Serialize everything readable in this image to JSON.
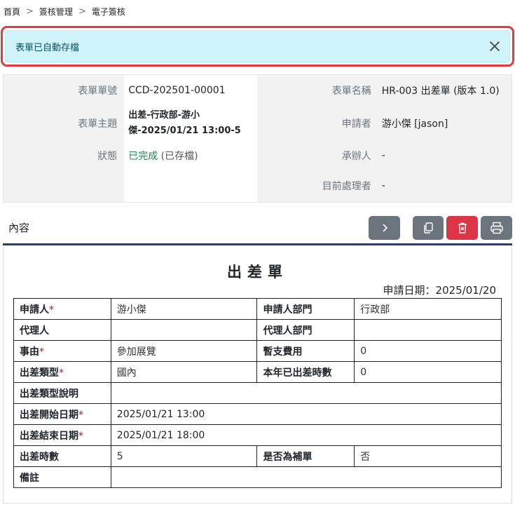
{
  "breadcrumb": [
    "首頁",
    "簽核管理",
    "電子簽核"
  ],
  "alert": {
    "text": "表單已自動存檔"
  },
  "info": {
    "form_no_label": "表單單號",
    "form_no": "CCD-202501-00001",
    "form_name_label": "表單名稱",
    "form_name": "HR-003 出差單 (版本 1.0)",
    "subject_label": "表單主題",
    "subject_line1": "出差-行政部-游小",
    "subject_line2": "傑-2025/01/21 13:00-5",
    "applicant_label": "申請者",
    "applicant": "游小傑 [jason]",
    "status_label": "狀態",
    "status_value": "已完成",
    "status_extra": "(已存檔)",
    "handler_label": "承辦人",
    "handler": "-",
    "processor_label": "目前處理者",
    "processor": "-"
  },
  "content": {
    "title": "內容"
  },
  "toolbar": {
    "next_icon": "chevron-right-icon",
    "copy_icon": "copy-icon",
    "delete_icon": "trash-icon",
    "print_icon": "printer-icon",
    "colors": {
      "gray": "#6c757d",
      "red": "#dc3545"
    }
  },
  "document": {
    "title": "出差單",
    "apply_date": "申請日期：2025/01/20",
    "rows": {
      "applicant_label": "申請人",
      "applicant": "游小傑",
      "dept_label": "申請人部門",
      "dept": "行政部",
      "agent_label": "代理人",
      "agent": "",
      "agent_dept_label": "代理人部門",
      "agent_dept": "",
      "reason_label": "事由",
      "reason": "參加展覽",
      "advance_label": "暫支費用",
      "advance": "0",
      "type_label": "出差類型",
      "type": "國內",
      "year_hours_label": "本年已出差時數",
      "year_hours": "0",
      "type_desc_label": "出差類型說明",
      "type_desc": "",
      "start_label": "出差開始日期",
      "start": "2025/01/21 13:00",
      "end_label": "出差結束日期",
      "end": "2025/01/21 18:00",
      "hours_label": "出差時數",
      "hours": "5",
      "supplement_label": "是否為補單",
      "supplement": "否",
      "note_label": "備註",
      "note": ""
    },
    "required_mark": "*"
  }
}
